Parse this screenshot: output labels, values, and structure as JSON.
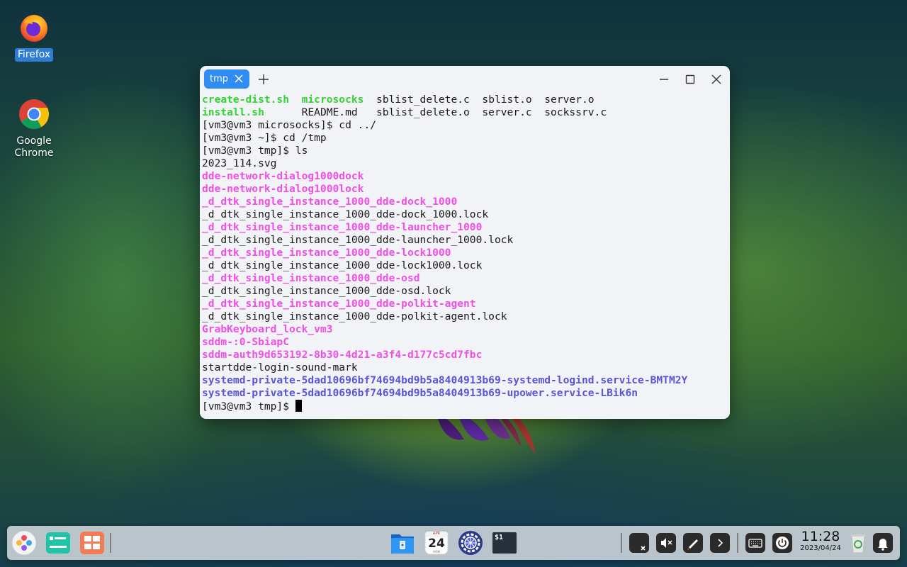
{
  "desktop": {
    "icons": [
      {
        "label": "Firefox",
        "icon": "firefox-icon"
      },
      {
        "label": "Google Chrome",
        "icon": "chrome-icon"
      }
    ]
  },
  "terminal": {
    "tab_title": "tmp",
    "lines": [
      [
        {
          "t": "create-dist.sh",
          "c": "g"
        },
        {
          "t": "  "
        },
        {
          "t": "microsocks",
          "c": "g"
        },
        {
          "t": "  sblist_delete.c  sblist.o  server.o"
        }
      ],
      [
        {
          "t": "install.sh",
          "c": "g"
        },
        {
          "t": "      README.md   sblist_delete.o  server.c  sockssrv.c"
        }
      ],
      [
        {
          "t": "[vm3@vm3 microsocks]$ cd ../"
        }
      ],
      [
        {
          "t": "[vm3@vm3 ~]$ cd /tmp"
        }
      ],
      [
        {
          "t": "[vm3@vm3 tmp]$ ls"
        }
      ],
      [
        {
          "t": "2023_114.svg"
        }
      ],
      [
        {
          "t": "dde-network-dialog1000dock",
          "c": "m"
        }
      ],
      [
        {
          "t": "dde-network-dialog1000lock",
          "c": "m"
        }
      ],
      [
        {
          "t": "_d_dtk_single_instance_1000_dde-dock_1000",
          "c": "m"
        }
      ],
      [
        {
          "t": "_d_dtk_single_instance_1000_dde-dock_1000.lock"
        }
      ],
      [
        {
          "t": "_d_dtk_single_instance_1000_dde-launcher_1000",
          "c": "m"
        }
      ],
      [
        {
          "t": "_d_dtk_single_instance_1000_dde-launcher_1000.lock"
        }
      ],
      [
        {
          "t": "_d_dtk_single_instance_1000_dde-lock1000",
          "c": "m"
        }
      ],
      [
        {
          "t": "_d_dtk_single_instance_1000_dde-lock1000.lock"
        }
      ],
      [
        {
          "t": "_d_dtk_single_instance_1000_dde-osd",
          "c": "m"
        }
      ],
      [
        {
          "t": "_d_dtk_single_instance_1000_dde-osd.lock"
        }
      ],
      [
        {
          "t": "_d_dtk_single_instance_1000_dde-polkit-agent",
          "c": "m"
        }
      ],
      [
        {
          "t": "_d_dtk_single_instance_1000_dde-polkit-agent.lock"
        }
      ],
      [
        {
          "t": "GrabKeyboard_lock_vm3",
          "c": "m"
        }
      ],
      [
        {
          "t": "sddm-:0-SbiapC",
          "c": "m"
        }
      ],
      [
        {
          "t": "sddm-auth9d653192-8b30-4d21-a3f4-d177c5cd7fbc",
          "c": "m"
        }
      ],
      [
        {
          "t": "startdde-login-sound-mark"
        }
      ],
      [
        {
          "t": "systemd-private-5dad10696bf74694bd9b5a8404913b69-systemd-logind.service-BMTM2Y",
          "c": "b"
        }
      ],
      [
        {
          "t": "systemd-private-5dad10696bf74694bd9b5a8404913b69-upower.service-LBik6n",
          "c": "b"
        }
      ],
      [
        {
          "t": "[vm3@vm3 tmp]$ "
        },
        {
          "cursor": true
        }
      ]
    ]
  },
  "taskbar": {
    "apps_left": [
      "launcher-icon",
      "multitasking-view-icon",
      "show-desktop-icon"
    ],
    "apps_center": [
      "file-manager-icon",
      "calendar-icon",
      "control-center-icon",
      "terminal-icon"
    ],
    "calendar_day": "24",
    "calendar_header": "APR",
    "calendar_footer": "MON",
    "terminal_glyph": "$1",
    "tray": [
      "network-disconnected-icon",
      "volume-muted-icon",
      "pen-icon",
      "expand-arrow-icon",
      "keyboard-icon",
      "power-icon"
    ],
    "clock_time": "11:28",
    "clock_date": "2023/04/24",
    "right": [
      "trash-icon",
      "notification-bell-icon"
    ]
  }
}
